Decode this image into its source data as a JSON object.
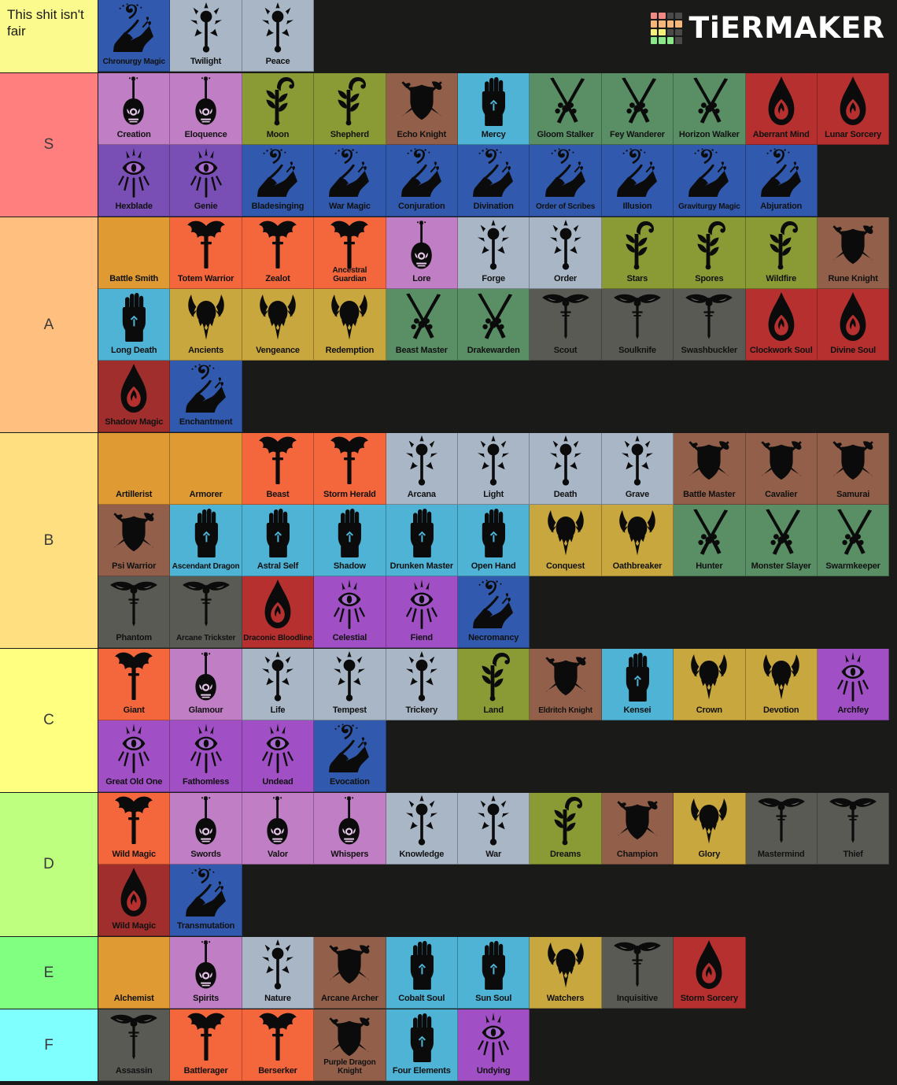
{
  "logo": {
    "text": "TiERMAKER",
    "grid_colors": [
      "#f08a84",
      "#f08a84",
      "#4a4a4a",
      "#4a4a4a",
      "#f5b67a",
      "#f5b67a",
      "#f5b67a",
      "#f5b67a",
      "#f5f07a",
      "#f5f07a",
      "#4a4a4a",
      "#4a4a4a",
      "#8ae88a",
      "#8ae88a",
      "#8ae88a",
      "#4a4a4a"
    ]
  },
  "unranked": {
    "label": "This shit isn't fair",
    "label_color": "#fbfb8d",
    "items": [
      {
        "name": "Chronurgy Magic",
        "icon": "wizard-hand-icon",
        "color": "#3159ad"
      },
      {
        "name": "Twilight",
        "icon": "cleric-sun-icon",
        "color": "#a8b6c6"
      },
      {
        "name": "Peace",
        "icon": "cleric-sun-icon",
        "color": "#a8b6c6"
      }
    ]
  },
  "tiers": [
    {
      "label": "S",
      "color": "#ff7f7f",
      "items": [
        {
          "name": "Creation",
          "icon": "bard-lute-icon",
          "color": "#c07fc5"
        },
        {
          "name": "Eloquence",
          "icon": "bard-lute-icon",
          "color": "#c07fc5"
        },
        {
          "name": "Moon",
          "icon": "druid-staff-icon",
          "color": "#8a9a35"
        },
        {
          "name": "Shepherd",
          "icon": "druid-staff-icon",
          "color": "#8a9a35"
        },
        {
          "name": "Echo Knight",
          "icon": "fighter-shield-icon",
          "color": "#92604a"
        },
        {
          "name": "Mercy",
          "icon": "monk-fist-icon",
          "color": "#4fb3d5"
        },
        {
          "name": "Gloom Stalker",
          "icon": "ranger-bow-icon",
          "color": "#5a8f66"
        },
        {
          "name": "Fey Wanderer",
          "icon": "ranger-bow-icon",
          "color": "#5a8f66"
        },
        {
          "name": "Horizon Walker",
          "icon": "ranger-bow-icon",
          "color": "#5a8f66"
        },
        {
          "name": "Aberrant Mind",
          "icon": "sorcerer-flame-icon",
          "color": "#b5302f"
        },
        {
          "name": "Lunar Sorcery",
          "icon": "sorcerer-flame-icon",
          "color": "#b5302f"
        },
        {
          "name": "Hexblade",
          "icon": "warlock-eye-icon",
          "color": "#7a4fb5"
        },
        {
          "name": "Genie",
          "icon": "warlock-eye-icon",
          "color": "#7a4fb5"
        },
        {
          "name": "Bladesinging",
          "icon": "wizard-hand-icon",
          "color": "#3159ad"
        },
        {
          "name": "War Magic",
          "icon": "wizard-hand-icon",
          "color": "#3159ad"
        },
        {
          "name": "Conjuration",
          "icon": "wizard-hand-icon",
          "color": "#3159ad"
        },
        {
          "name": "Divination",
          "icon": "wizard-hand-icon",
          "color": "#3159ad"
        },
        {
          "name": "Order of Scribes",
          "icon": "wizard-hand-icon",
          "color": "#3159ad"
        },
        {
          "name": "Illusion",
          "icon": "wizard-hand-icon",
          "color": "#3159ad"
        },
        {
          "name": "Graviturgy Magic",
          "icon": "wizard-hand-icon",
          "color": "#3159ad"
        },
        {
          "name": "Abjuration",
          "icon": "wizard-hand-icon",
          "color": "#3159ad"
        }
      ]
    },
    {
      "label": "A",
      "color": "#ffbf7f",
      "items": [
        {
          "name": "Battle Smith",
          "icon": "artificer-gear-icon",
          "color": "#df9a34"
        },
        {
          "name": "Totem Warrior",
          "icon": "barbarian-axe-icon",
          "color": "#f4673c"
        },
        {
          "name": "Zealot",
          "icon": "barbarian-axe-icon",
          "color": "#f4673c"
        },
        {
          "name": "Ancestral Guardian",
          "icon": "barbarian-axe-icon",
          "color": "#f4673c"
        },
        {
          "name": "Lore",
          "icon": "bard-lute-icon",
          "color": "#c07fc5"
        },
        {
          "name": "Forge",
          "icon": "cleric-sun-icon",
          "color": "#a8b6c6"
        },
        {
          "name": "Order",
          "icon": "cleric-sun-icon",
          "color": "#a8b6c6"
        },
        {
          "name": "Stars",
          "icon": "druid-staff-icon",
          "color": "#8a9a35"
        },
        {
          "name": "Spores",
          "icon": "druid-staff-icon",
          "color": "#8a9a35"
        },
        {
          "name": "Wildfire",
          "icon": "druid-staff-icon",
          "color": "#8a9a35"
        },
        {
          "name": "Rune Knight",
          "icon": "fighter-shield-icon",
          "color": "#92604a"
        },
        {
          "name": "Long Death",
          "icon": "monk-fist-icon",
          "color": "#4fb3d5"
        },
        {
          "name": "Ancients",
          "icon": "paladin-helm-icon",
          "color": "#c9a73f"
        },
        {
          "name": "Vengeance",
          "icon": "paladin-helm-icon",
          "color": "#c9a73f"
        },
        {
          "name": "Redemption",
          "icon": "paladin-helm-icon",
          "color": "#c9a73f"
        },
        {
          "name": "Beast Master",
          "icon": "ranger-bow-icon",
          "color": "#5a8f66"
        },
        {
          "name": "Drakewarden",
          "icon": "ranger-bow-icon",
          "color": "#5a8f66"
        },
        {
          "name": "Scout",
          "icon": "rogue-dagger-icon",
          "color": "#5a5a55"
        },
        {
          "name": "Soulknife",
          "icon": "rogue-dagger-icon",
          "color": "#5a5a55"
        },
        {
          "name": "Swashbuckler",
          "icon": "rogue-dagger-icon",
          "color": "#5a5a55"
        },
        {
          "name": "Clockwork Soul",
          "icon": "sorcerer-flame-icon",
          "color": "#b5302f"
        },
        {
          "name": "Divine Soul",
          "icon": "sorcerer-flame-icon",
          "color": "#b5302f"
        },
        {
          "name": "Shadow Magic",
          "icon": "sorcerer-flame-icon",
          "color": "#a02e2c"
        },
        {
          "name": "Enchantment",
          "icon": "wizard-hand-icon",
          "color": "#3159ad"
        }
      ]
    },
    {
      "label": "B",
      "color": "#ffdf80",
      "items": [
        {
          "name": "Artillerist",
          "icon": "artificer-gear-icon",
          "color": "#df9a34"
        },
        {
          "name": "Armorer",
          "icon": "artificer-gear-icon",
          "color": "#df9a34"
        },
        {
          "name": "Beast",
          "icon": "barbarian-axe-icon",
          "color": "#f4673c"
        },
        {
          "name": "Storm Herald",
          "icon": "barbarian-axe-icon",
          "color": "#f4673c"
        },
        {
          "name": "Arcana",
          "icon": "cleric-sun-icon",
          "color": "#a8b6c6"
        },
        {
          "name": "Light",
          "icon": "cleric-sun-icon",
          "color": "#a8b6c6"
        },
        {
          "name": "Death",
          "icon": "cleric-sun-icon",
          "color": "#a8b6c6"
        },
        {
          "name": "Grave",
          "icon": "cleric-sun-icon",
          "color": "#a8b6c6"
        },
        {
          "name": "Battle Master",
          "icon": "fighter-shield-icon",
          "color": "#92604a"
        },
        {
          "name": "Cavalier",
          "icon": "fighter-shield-icon",
          "color": "#92604a"
        },
        {
          "name": "Samurai",
          "icon": "fighter-shield-icon",
          "color": "#92604a"
        },
        {
          "name": "Psi Warrior",
          "icon": "fighter-shield-icon",
          "color": "#92604a"
        },
        {
          "name": "Ascendant Dragon",
          "icon": "monk-fist-icon",
          "color": "#4fb3d5"
        },
        {
          "name": "Astral Self",
          "icon": "monk-fist-icon",
          "color": "#4fb3d5"
        },
        {
          "name": "Shadow",
          "icon": "monk-fist-icon",
          "color": "#4fb3d5"
        },
        {
          "name": "Drunken Master",
          "icon": "monk-fist-icon",
          "color": "#4fb3d5"
        },
        {
          "name": "Open Hand",
          "icon": "monk-fist-icon",
          "color": "#4fb3d5"
        },
        {
          "name": "Conquest",
          "icon": "paladin-helm-icon",
          "color": "#c9a73f"
        },
        {
          "name": "Oathbreaker",
          "icon": "paladin-helm-icon",
          "color": "#c9a73f"
        },
        {
          "name": "Hunter",
          "icon": "ranger-bow-icon",
          "color": "#5a8f66"
        },
        {
          "name": "Monster Slayer",
          "icon": "ranger-bow-icon",
          "color": "#5a8f66"
        },
        {
          "name": "Swarmkeeper",
          "icon": "ranger-bow-icon",
          "color": "#5a8f66"
        },
        {
          "name": "Phantom",
          "icon": "rogue-dagger-icon",
          "color": "#5a5a55"
        },
        {
          "name": "Arcane Trickster",
          "icon": "rogue-dagger-icon",
          "color": "#5a5a55"
        },
        {
          "name": "Draconic Bloodline",
          "icon": "sorcerer-flame-icon",
          "color": "#b5302f"
        },
        {
          "name": "Celestial",
          "icon": "warlock-eye-icon",
          "color": "#a04fc5"
        },
        {
          "name": "Fiend",
          "icon": "warlock-eye-icon",
          "color": "#a04fc5"
        },
        {
          "name": "Necromancy",
          "icon": "wizard-hand-icon",
          "color": "#3159ad"
        }
      ]
    },
    {
      "label": "C",
      "color": "#ffff80",
      "items": [
        {
          "name": "Giant",
          "icon": "barbarian-axe-icon",
          "color": "#f4673c"
        },
        {
          "name": "Glamour",
          "icon": "bard-lute-icon",
          "color": "#c07fc5"
        },
        {
          "name": "Life",
          "icon": "cleric-sun-icon",
          "color": "#a8b6c6"
        },
        {
          "name": "Tempest",
          "icon": "cleric-sun-icon",
          "color": "#a8b6c6"
        },
        {
          "name": "Trickery",
          "icon": "cleric-sun-icon",
          "color": "#a8b6c6"
        },
        {
          "name": "Land",
          "icon": "druid-staff-icon",
          "color": "#8a9a35"
        },
        {
          "name": "Eldritch Knight",
          "icon": "fighter-shield-icon",
          "color": "#92604a"
        },
        {
          "name": "Kensei",
          "icon": "monk-fist-icon",
          "color": "#4fb3d5"
        },
        {
          "name": "Crown",
          "icon": "paladin-helm-icon",
          "color": "#c9a73f"
        },
        {
          "name": "Devotion",
          "icon": "paladin-helm-icon",
          "color": "#c9a73f"
        },
        {
          "name": "Archfey",
          "icon": "warlock-eye-icon",
          "color": "#a04fc5"
        },
        {
          "name": "Great Old One",
          "icon": "warlock-eye-icon",
          "color": "#a04fc5"
        },
        {
          "name": "Fathomless",
          "icon": "warlock-eye-icon",
          "color": "#a04fc5"
        },
        {
          "name": "Undead",
          "icon": "warlock-eye-icon",
          "color": "#a04fc5"
        },
        {
          "name": "Evocation",
          "icon": "wizard-hand-icon",
          "color": "#3159ad"
        }
      ]
    },
    {
      "label": "D",
      "color": "#bfff80",
      "items": [
        {
          "name": "Wild Magic",
          "icon": "barbarian-axe-icon",
          "color": "#f4673c"
        },
        {
          "name": "Swords",
          "icon": "bard-lute-icon",
          "color": "#c07fc5"
        },
        {
          "name": "Valor",
          "icon": "bard-lute-icon",
          "color": "#c07fc5"
        },
        {
          "name": "Whispers",
          "icon": "bard-lute-icon",
          "color": "#c07fc5"
        },
        {
          "name": "Knowledge",
          "icon": "cleric-sun-icon",
          "color": "#a8b6c6"
        },
        {
          "name": "War",
          "icon": "cleric-sun-icon",
          "color": "#a8b6c6"
        },
        {
          "name": "Dreams",
          "icon": "druid-staff-icon",
          "color": "#8a9a35"
        },
        {
          "name": "Champion",
          "icon": "fighter-shield-icon",
          "color": "#92604a"
        },
        {
          "name": "Glory",
          "icon": "paladin-helm-icon",
          "color": "#c9a73f"
        },
        {
          "name": "Mastermind",
          "icon": "rogue-dagger-icon",
          "color": "#5a5a55"
        },
        {
          "name": "Thief",
          "icon": "rogue-dagger-icon",
          "color": "#5a5a55"
        },
        {
          "name": "Wild Magic",
          "icon": "sorcerer-flame-icon",
          "color": "#a02e2c"
        },
        {
          "name": "Transmutation",
          "icon": "wizard-hand-icon",
          "color": "#3159ad"
        }
      ]
    },
    {
      "label": "E",
      "color": "#80ff80",
      "items": [
        {
          "name": "Alchemist",
          "icon": "artificer-gear-icon",
          "color": "#df9a34"
        },
        {
          "name": "Spirits",
          "icon": "bard-lute-icon",
          "color": "#c07fc5"
        },
        {
          "name": "Nature",
          "icon": "cleric-sun-icon",
          "color": "#a8b6c6"
        },
        {
          "name": "Arcane Archer",
          "icon": "fighter-shield-icon",
          "color": "#92604a"
        },
        {
          "name": "Cobalt Soul",
          "icon": "monk-fist-icon",
          "color": "#4fb3d5"
        },
        {
          "name": "Sun Soul",
          "icon": "monk-fist-icon",
          "color": "#4fb3d5"
        },
        {
          "name": "Watchers",
          "icon": "paladin-helm-icon",
          "color": "#c9a73f"
        },
        {
          "name": "Inquisitive",
          "icon": "rogue-dagger-icon",
          "color": "#5a5a55"
        },
        {
          "name": "Storm Sorcery",
          "icon": "sorcerer-flame-icon",
          "color": "#b5302f"
        }
      ]
    },
    {
      "label": "F",
      "color": "#80ffff",
      "items": [
        {
          "name": "Assassin",
          "icon": "rogue-dagger-icon",
          "color": "#5a5a55"
        },
        {
          "name": "Battlerager",
          "icon": "barbarian-axe-icon",
          "color": "#f4673c"
        },
        {
          "name": "Berserker",
          "icon": "barbarian-axe-icon",
          "color": "#f4673c"
        },
        {
          "name": "Purple Dragon Knight",
          "icon": "fighter-shield-icon",
          "color": "#92604a"
        },
        {
          "name": "Four Elements",
          "icon": "monk-fist-icon",
          "color": "#4fb3d5"
        },
        {
          "name": "Undying",
          "icon": "warlock-eye-icon",
          "color": "#a04fc5"
        }
      ]
    }
  ]
}
